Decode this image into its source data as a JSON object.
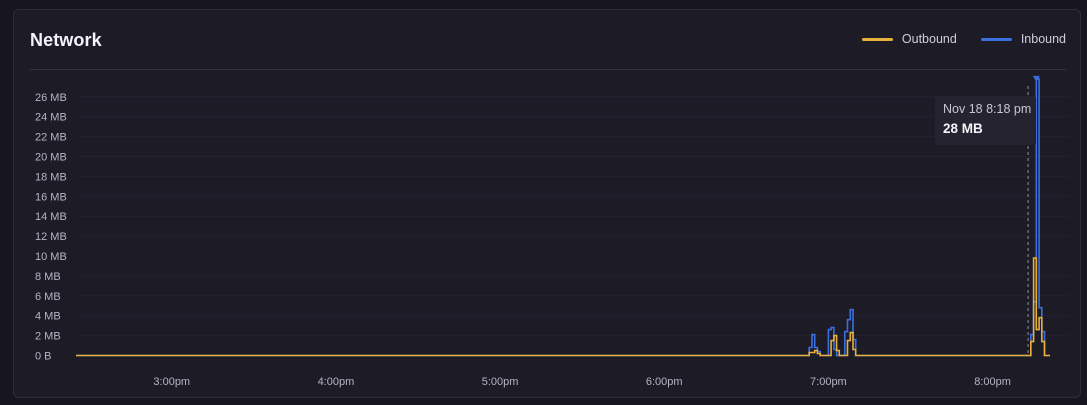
{
  "panel": {
    "title": "Network"
  },
  "legend": [
    {
      "label": "Outbound",
      "color": "#e7b03c"
    },
    {
      "label": "Inbound",
      "color": "#3a6fe0"
    }
  ],
  "tooltip": {
    "time": "Nov 18 8:18 pm",
    "value": "28 MB"
  },
  "chart_data": {
    "type": "line",
    "title": "Network",
    "xlabel": "",
    "ylabel": "",
    "y_unit": "MB",
    "ylim": [
      0,
      27
    ],
    "y_ticks": [
      0,
      2,
      4,
      6,
      8,
      10,
      12,
      14,
      16,
      18,
      20,
      22,
      24,
      26
    ],
    "y_tick_labels": [
      "0 B",
      "2 MB",
      "4 MB",
      "6 MB",
      "8 MB",
      "10 MB",
      "12 MB",
      "14 MB",
      "16 MB",
      "18 MB",
      "20 MB",
      "22 MB",
      "24 MB",
      "26 MB"
    ],
    "x_domain": [
      "2:25pm",
      "8:21pm"
    ],
    "x_tick_labels": [
      "3:00pm",
      "4:00pm",
      "5:00pm",
      "6:00pm",
      "7:00pm",
      "8:00pm"
    ],
    "x_ticks": [
      "15:00",
      "16:00",
      "17:00",
      "18:00",
      "19:00",
      "20:00"
    ],
    "grid": true,
    "legend_position": "top-right",
    "hover_time": "20:13",
    "series": [
      {
        "name": "Outbound",
        "color": "#e7b03c",
        "points": [
          [
            "14:25",
            0
          ],
          [
            "18:52",
            0
          ],
          [
            "18:53",
            0.3
          ],
          [
            "18:55",
            0.5
          ],
          [
            "18:56",
            0.2
          ],
          [
            "18:57",
            0
          ],
          [
            "19:00",
            0
          ],
          [
            "19:01",
            1.5
          ],
          [
            "19:02",
            2.0
          ],
          [
            "19:03",
            0.5
          ],
          [
            "19:04",
            0
          ],
          [
            "19:06",
            0
          ],
          [
            "19:07",
            1.5
          ],
          [
            "19:08",
            2.3
          ],
          [
            "19:09",
            0.6
          ],
          [
            "19:10",
            0
          ],
          [
            "20:13",
            0
          ],
          [
            "20:14",
            1.4
          ],
          [
            "20:15",
            9.8
          ],
          [
            "20:16",
            2.6
          ],
          [
            "20:17",
            3.8
          ],
          [
            "20:18",
            1.4
          ],
          [
            "20:19",
            0
          ],
          [
            "20:21",
            0
          ]
        ]
      },
      {
        "name": "Inbound",
        "color": "#3a6fe0",
        "points": [
          [
            "14:25",
            0
          ],
          [
            "18:52",
            0
          ],
          [
            "18:53",
            0.8
          ],
          [
            "18:54",
            2.1
          ],
          [
            "18:55",
            0.8
          ],
          [
            "18:56",
            0.4
          ],
          [
            "18:57",
            0
          ],
          [
            "18:59",
            0
          ],
          [
            "19:00",
            2.6
          ],
          [
            "19:01",
            2.8
          ],
          [
            "19:02",
            0.6
          ],
          [
            "19:03",
            0
          ],
          [
            "19:05",
            0
          ],
          [
            "19:06",
            2.4
          ],
          [
            "19:07",
            3.6
          ],
          [
            "19:08",
            4.6
          ],
          [
            "19:09",
            1.6
          ],
          [
            "19:10",
            0
          ],
          [
            "20:13",
            0
          ],
          [
            "20:14",
            2.1
          ],
          [
            "20:15",
            5.4
          ],
          [
            "20:16",
            27.8
          ],
          [
            "20:17",
            4.8
          ],
          [
            "20:18",
            2.4
          ],
          [
            "20:19",
            0
          ],
          [
            "20:21",
            0
          ]
        ]
      }
    ]
  }
}
